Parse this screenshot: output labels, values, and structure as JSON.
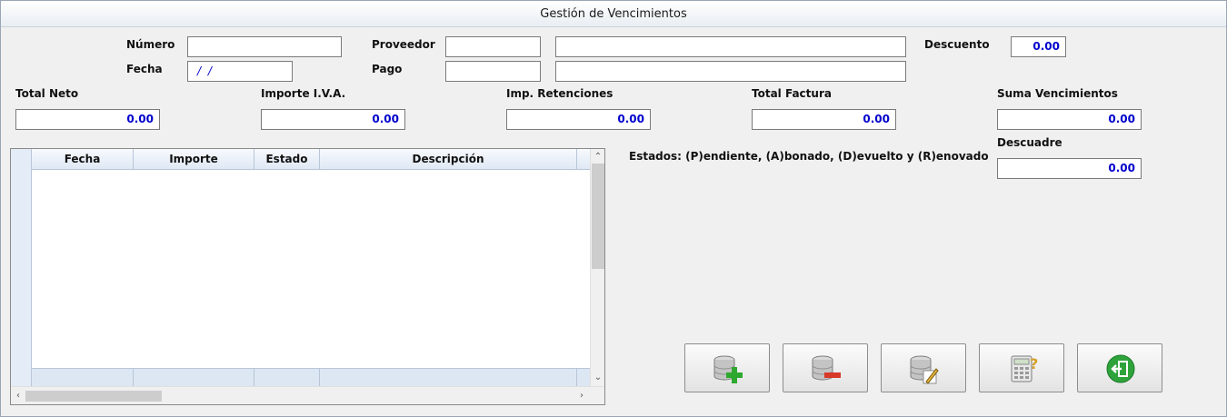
{
  "window": {
    "title": "Gestión de Vencimientos"
  },
  "header": {
    "numero_label": "Número",
    "numero_value": "",
    "fecha_label": "Fecha",
    "fecha_value": "/ /",
    "proveedor_label": "Proveedor",
    "proveedor_code": "",
    "proveedor_name": "",
    "pago_label": "Pago",
    "pago_code": "",
    "pago_name": "",
    "descuento_label": "Descuento",
    "descuento_value": "0.00"
  },
  "totals": {
    "total_neto_label": "Total Neto",
    "total_neto_value": "0.00",
    "importe_iva_label": "Importe I.V.A.",
    "importe_iva_value": "0.00",
    "retenciones_label": "Imp. Retenciones",
    "retenciones_value": "0.00",
    "total_factura_label": "Total Factura",
    "total_factura_value": "0.00",
    "suma_venc_label": "Suma Vencimientos",
    "suma_venc_value": "0.00",
    "descuadre_label": "Descuadre",
    "descuadre_value": "0.00"
  },
  "grid": {
    "columns": [
      "Fecha",
      "Importe",
      "Estado",
      "Descripción"
    ],
    "rows": []
  },
  "estados_text": "Estados: (P)endiente, (A)bonado, (D)evuelto y (R)enovado",
  "buttons": [
    {
      "name": "add-record-button",
      "icon": "database-add-icon"
    },
    {
      "name": "remove-record-button",
      "icon": "database-remove-icon"
    },
    {
      "name": "edit-record-button",
      "icon": "database-edit-icon"
    },
    {
      "name": "calculator-button",
      "icon": "calculator-help-icon"
    },
    {
      "name": "exit-button",
      "icon": "exit-door-icon"
    }
  ],
  "colors": {
    "value_text": "#0000cc",
    "add_green": "#2fa82f",
    "remove_red": "#d83a2a"
  }
}
